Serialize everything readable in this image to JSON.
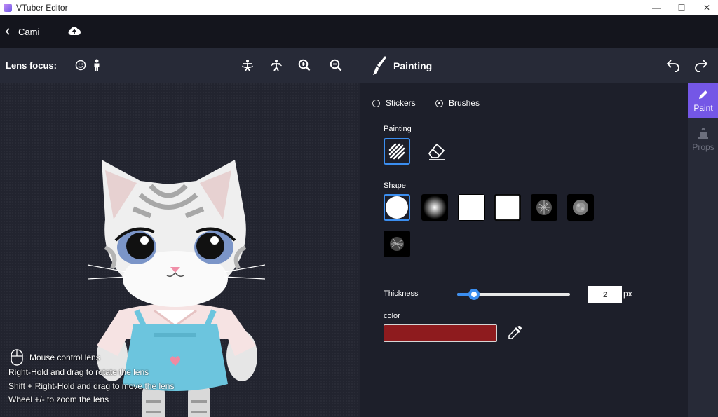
{
  "window": {
    "title": "VTuber Editor",
    "minimize": "—",
    "maximize": "☐",
    "close": "✕"
  },
  "header": {
    "back_label": "Cami"
  },
  "lens": {
    "title": "Lens focus:",
    "hints": {
      "mouse_label": "Mouse control lens",
      "lines": [
        "Right-Hold and drag to rotate the lens",
        "Shift + Right-Hold and drag to move the lens",
        "Wheel +/- to zoom the lens"
      ]
    }
  },
  "painting_panel": {
    "title": "Painting",
    "mode_options": [
      {
        "label": "Stickers",
        "checked": false
      },
      {
        "label": "Brushes",
        "checked": true
      }
    ],
    "painting_label": "Painting",
    "shape_label": "Shape",
    "thickness_label": "Thickness",
    "thickness_value": "2",
    "thickness_fraction": 0.11,
    "thickness_unit": "px",
    "color_label": "color",
    "color_value": "#8e1b1e",
    "accent": "#3b8ef0",
    "tabs": [
      {
        "label": "Paint",
        "icon": "pencil-icon",
        "active": true
      },
      {
        "label": "Props",
        "icon": "hat-icon",
        "active": false
      }
    ]
  }
}
